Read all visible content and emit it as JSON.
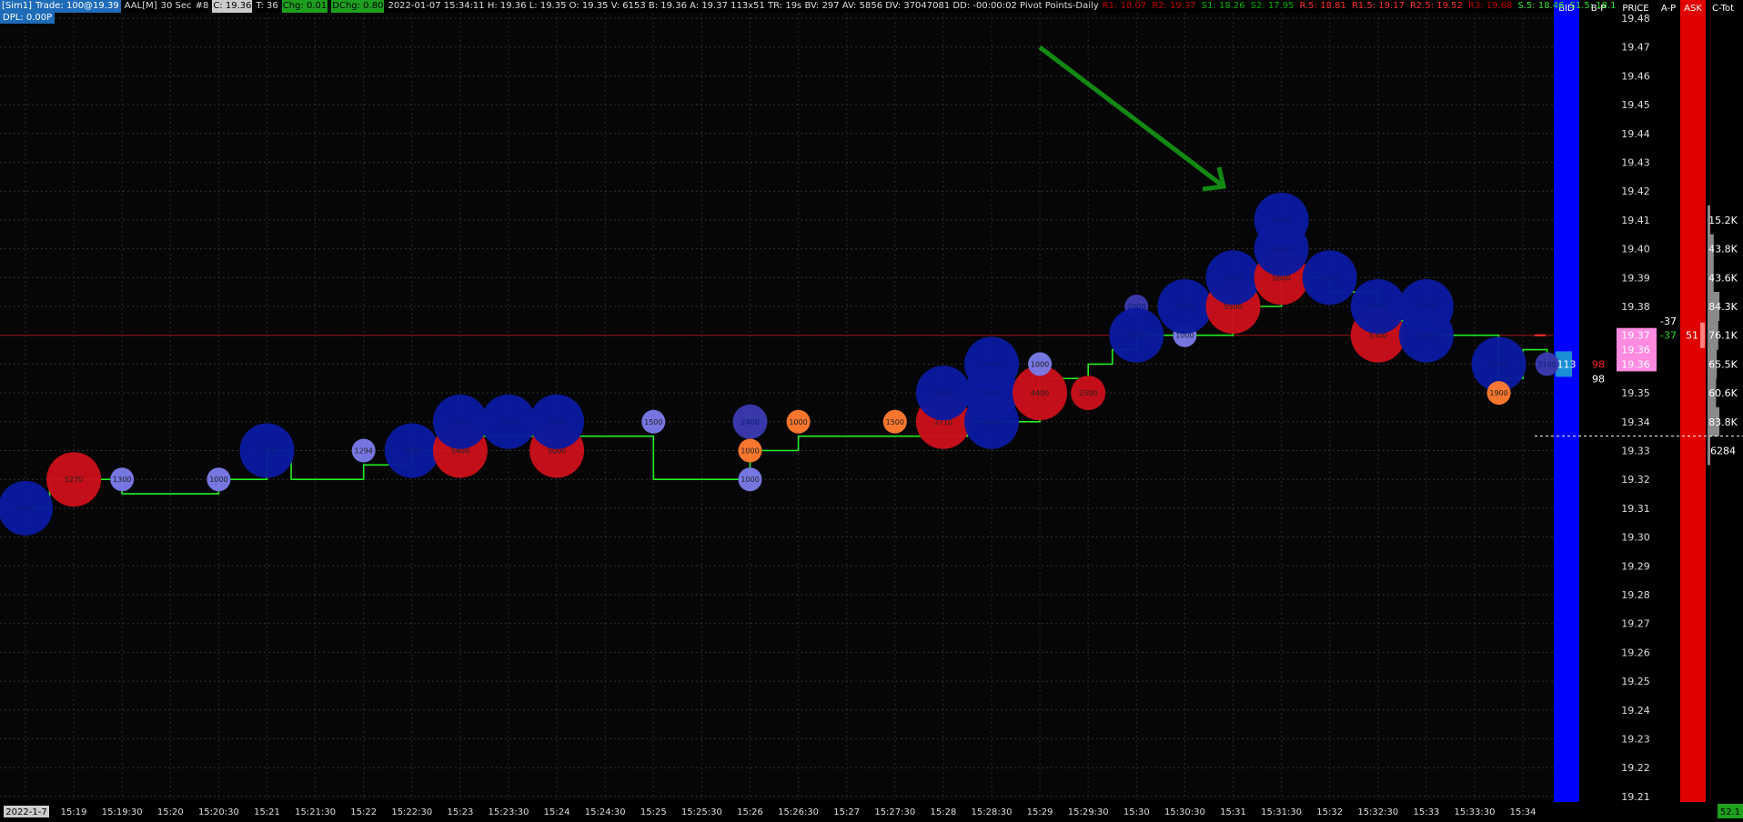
{
  "header": {
    "sim": "[Sim1]",
    "trade": "Trade: 100@19.39",
    "symbol": "AAL[M]",
    "interval": "30 Sec",
    "num": "#8",
    "close": "C: 19.36",
    "t": "T: 36",
    "chg": "Chg: 0.01",
    "dchg": "DChg: 0.80",
    "info": "2022-01-07 15:34:11 H: 19.36 L: 19.35 O: 19.35 V: 6153 B: 19.36 A: 19.37 113x51 TR: 19s BV: 297 AV: 5856 DV: 37047081 DD: -00:00:02 Pivot Points-Daily",
    "pivots": [
      {
        "text": "R1: 18.07",
        "color": "#c00000"
      },
      {
        "text": "R2: 19.37",
        "color": "#c00000"
      },
      {
        "text": "S1: 18.26",
        "color": "#00b000"
      },
      {
        "text": "S2: 17.95",
        "color": "#00b000"
      },
      {
        "text": "R.5: 18.81",
        "color": "#ff3030"
      },
      {
        "text": "R1.5: 19.17",
        "color": "#ff3030"
      },
      {
        "text": "R2.5: 19.52",
        "color": "#ff3030"
      },
      {
        "text": "R3: 19.68",
        "color": "#c00000"
      },
      {
        "text": "S.5: 18.46",
        "color": "#30e030"
      },
      {
        "text": "S1.5: 18.1",
        "color": "#30e030"
      }
    ],
    "dpl": "DPL: 0.00P"
  },
  "colors": {
    "line": "#22ee22",
    "bid": "#0a1a9e",
    "ask": "#c8101a",
    "small_bid": "#7a7ae8",
    "small_ask": "#ff7a30",
    "mid_bid": "#3a3ab0",
    "bid_col": "#0000ff",
    "ask_col": "#e00000",
    "pink": "#ff8ae0",
    "arrow": "#138a13"
  },
  "chart_data": {
    "type": "line",
    "title": "",
    "y_ticks": [
      "19.48",
      "19.47",
      "19.46",
      "19.45",
      "19.44",
      "19.43",
      "19.42",
      "19.41",
      "19.40",
      "19.39",
      "19.38",
      "19.37",
      "19.36",
      "19.35",
      "19.34",
      "19.33",
      "19.32",
      "19.31",
      "19.30",
      "19.29",
      "19.28",
      "19.27",
      "19.26",
      "19.25",
      "19.24",
      "19.23",
      "19.22",
      "19.21"
    ],
    "ylim": [
      19.21,
      19.48
    ],
    "x_labels": [
      "2022-1-7",
      "15:19",
      "15:19:30",
      "15:20",
      "15:20:30",
      "15:21",
      "15:21:30",
      "15:22",
      "15:22:30",
      "15:23",
      "15:23:30",
      "15:24",
      "15:24:30",
      "15:25",
      "15:25:30",
      "15:26",
      "15:26:30",
      "15:27",
      "15:27:30",
      "15:28",
      "15:28:30",
      "15:29",
      "15:29:30",
      "15:30",
      "15:30:30",
      "15:31",
      "15:31:30",
      "15:32",
      "15:32:30",
      "15:33",
      "15:33:30",
      "15:34"
    ],
    "price_steps": [
      [
        0,
        19.31
      ],
      [
        0.5,
        19.32
      ],
      [
        1.5,
        19.32
      ],
      [
        2,
        19.315
      ],
      [
        4,
        19.32
      ],
      [
        5,
        19.33
      ],
      [
        5.5,
        19.32
      ],
      [
        7,
        19.325
      ],
      [
        8,
        19.33
      ],
      [
        9,
        19.335
      ],
      [
        12,
        19.335
      ],
      [
        13,
        19.32
      ],
      [
        14.5,
        19.32
      ],
      [
        15,
        19.33
      ],
      [
        16,
        19.335
      ],
      [
        19,
        19.335
      ],
      [
        19.5,
        19.34
      ],
      [
        21,
        19.355
      ],
      [
        22,
        19.36
      ],
      [
        22.5,
        19.365
      ],
      [
        23,
        19.37
      ],
      [
        24.5,
        19.37
      ],
      [
        25,
        19.38
      ],
      [
        26,
        19.39
      ],
      [
        27,
        19.385
      ],
      [
        28,
        19.375
      ],
      [
        29,
        19.37
      ],
      [
        30.5,
        19.355
      ],
      [
        31,
        19.365
      ],
      [
        31.5,
        19.36
      ]
    ],
    "bubbles": [
      {
        "x": 0,
        "price": 19.31,
        "size": "L",
        "side": "bid",
        "label": "4400"
      },
      {
        "x": 1,
        "price": 19.32,
        "size": "L",
        "side": "ask",
        "label": "5270"
      },
      {
        "x": 2,
        "price": 19.32,
        "size": "S",
        "side": "small_bid",
        "label": "1300"
      },
      {
        "x": 4,
        "price": 19.32,
        "size": "S",
        "side": "small_bid",
        "label": "1000"
      },
      {
        "x": 5,
        "price": 19.33,
        "size": "L",
        "side": "bid",
        "label": "5100"
      },
      {
        "x": 7,
        "price": 19.33,
        "size": "S",
        "side": "small_bid",
        "label": "1294"
      },
      {
        "x": 8,
        "price": 19.33,
        "size": "L",
        "side": "bid",
        "label": "4800"
      },
      {
        "x": 9,
        "price": 19.33,
        "size": "L",
        "side": "ask",
        "label": "5400"
      },
      {
        "x": 9,
        "price": 19.34,
        "size": "L",
        "side": "bid",
        "label": "5100"
      },
      {
        "x": 10,
        "price": 19.34,
        "size": "L",
        "side": "bid",
        "label": "5130"
      },
      {
        "x": 11,
        "price": 19.33,
        "size": "L",
        "side": "ask",
        "label": "5000"
      },
      {
        "x": 11,
        "price": 19.34,
        "size": "L",
        "side": "bid",
        "label": "5400"
      },
      {
        "x": 13,
        "price": 19.34,
        "size": "S",
        "side": "small_bid",
        "label": "1500"
      },
      {
        "x": 15,
        "price": 19.34,
        "size": "M",
        "side": "mid_bid",
        "label": "2400"
      },
      {
        "x": 15,
        "price": 19.33,
        "size": "S",
        "side": "small_ask",
        "label": "1000"
      },
      {
        "x": 15,
        "price": 19.32,
        "size": "S",
        "side": "small_bid",
        "label": "1000"
      },
      {
        "x": 16,
        "price": 19.34,
        "size": "S",
        "side": "small_ask",
        "label": "1000"
      },
      {
        "x": 18,
        "price": 19.34,
        "size": "S",
        "side": "small_ask",
        "label": "1500"
      },
      {
        "x": 19,
        "price": 19.34,
        "size": "L",
        "side": "ask",
        "label": "3710"
      },
      {
        "x": 19,
        "price": 19.35,
        "size": "L",
        "side": "bid",
        "label": "5300"
      },
      {
        "x": 20,
        "price": 19.36,
        "size": "L",
        "side": "bid",
        "label": "5200"
      },
      {
        "x": 20,
        "price": 19.35,
        "size": "L",
        "side": "bid",
        "label": "5000"
      },
      {
        "x": 20,
        "price": 19.34,
        "size": "L",
        "side": "bid",
        "label": "4800"
      },
      {
        "x": 21,
        "price": 19.35,
        "size": "L",
        "side": "ask",
        "label": "4400"
      },
      {
        "x": 21,
        "price": 19.36,
        "size": "S",
        "side": "small_bid",
        "label": "1000"
      },
      {
        "x": 22,
        "price": 19.35,
        "size": "M",
        "side": "ask",
        "label": "2500"
      },
      {
        "x": 23,
        "price": 19.38,
        "size": "S",
        "side": "mid_bid",
        "label": "2000"
      },
      {
        "x": 23,
        "price": 19.37,
        "size": "L",
        "side": "bid",
        "label": "4800"
      },
      {
        "x": 24,
        "price": 19.37,
        "size": "S",
        "side": "small_bid",
        "label": "1000"
      },
      {
        "x": 24,
        "price": 19.38,
        "size": "L",
        "side": "bid",
        "label": "5100"
      },
      {
        "x": 25,
        "price": 19.38,
        "size": "L",
        "side": "ask",
        "label": "5500"
      },
      {
        "x": 25,
        "price": 19.39,
        "size": "L",
        "side": "bid",
        "label": "5000"
      },
      {
        "x": 26,
        "price": 19.39,
        "size": "L",
        "side": "ask",
        "label": "5600"
      },
      {
        "x": 26,
        "price": 19.4,
        "size": "L",
        "side": "bid",
        "label": "5300"
      },
      {
        "x": 26,
        "price": 19.41,
        "size": "L",
        "side": "bid",
        "label": "5100"
      },
      {
        "x": 27,
        "price": 19.39,
        "size": "L",
        "side": "bid",
        "label": "5200"
      },
      {
        "x": 28,
        "price": 19.37,
        "size": "L",
        "side": "ask",
        "label": "5300"
      },
      {
        "x": 28,
        "price": 19.38,
        "size": "L",
        "side": "bid",
        "label": "5100"
      },
      {
        "x": 29,
        "price": 19.38,
        "size": "L",
        "side": "bid",
        "label": "5200"
      },
      {
        "x": 29,
        "price": 19.37,
        "size": "L",
        "side": "bid",
        "label": "5000"
      },
      {
        "x": 30.5,
        "price": 19.36,
        "size": "L",
        "side": "bid",
        "label": "5400"
      },
      {
        "x": 30.5,
        "price": 19.35,
        "size": "S",
        "side": "small_ask",
        "label": "1900"
      },
      {
        "x": 31.5,
        "price": 19.36,
        "size": "S",
        "side": "mid_bid",
        "label": "2100"
      }
    ],
    "current_price": 19.36,
    "red_line_price": 19.37,
    "dotted_line_price": 19.335
  },
  "ladder": {
    "headers": {
      "bid": "BID",
      "bp": "B-P",
      "price": "PRICE",
      "ap": "A-P",
      "ask": "ASK",
      "ctot": "C-Tot"
    },
    "bid_size": "113",
    "bp_values": [
      {
        "price": 19.36,
        "text": "98",
        "color": "#ff2020"
      },
      {
        "price": 19.355,
        "text": "98",
        "color": "#ffffff"
      }
    ],
    "price_cells": [
      {
        "price": 19.37,
        "text": "19.37"
      },
      {
        "price": 19.365,
        "text": "19.36"
      },
      {
        "price": 19.36,
        "text": "19.36"
      }
    ],
    "ap_values": [
      {
        "price": 19.375,
        "text": "-37",
        "color": "#ffffff"
      },
      {
        "price": 19.37,
        "text": "-37",
        "color": "#22dd22"
      }
    ],
    "ask_size": "51",
    "ctot": [
      {
        "price": 19.41,
        "text": "15.2K",
        "value": 15.2
      },
      {
        "price": 19.4,
        "text": "43.8K",
        "value": 43.8
      },
      {
        "price": 19.39,
        "text": "43.6K",
        "value": 43.6
      },
      {
        "price": 19.38,
        "text": "84.3K",
        "value": 84.3
      },
      {
        "price": 19.37,
        "text": "76.1K",
        "value": 76.1
      },
      {
        "price": 19.36,
        "text": "65.5K",
        "value": 65.5
      },
      {
        "price": 19.35,
        "text": "60.6K",
        "value": 60.6
      },
      {
        "price": 19.34,
        "text": "83.8K",
        "value": 83.8
      },
      {
        "price": 19.33,
        "text": "6284",
        "value": 6.3
      }
    ],
    "corner": "52.1"
  }
}
